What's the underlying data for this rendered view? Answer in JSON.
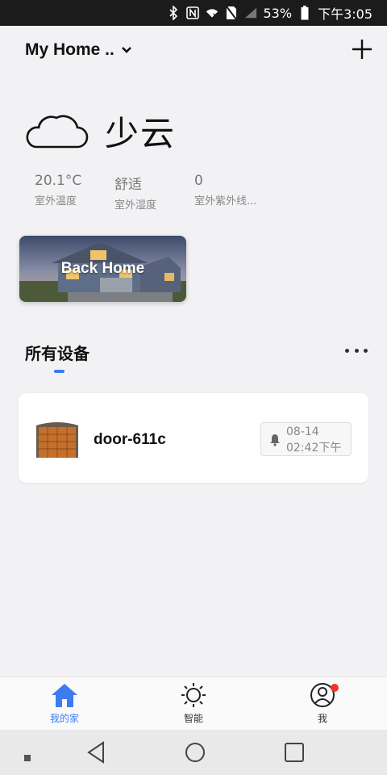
{
  "status_bar": {
    "battery": "53%",
    "time": "下午3:05",
    "icons": [
      "bluetooth-icon",
      "nfc-icon",
      "wifi-icon",
      "no-sim-icon",
      "signal-icon",
      "battery-icon"
    ]
  },
  "header": {
    "home_name": "My Home ..",
    "add_icon": "plus-icon"
  },
  "weather": {
    "condition": "少云",
    "icon": "cloud-icon",
    "stats": [
      {
        "value": "20.1°C",
        "label": "室外温度"
      },
      {
        "value": "舒适",
        "label": "室外湿度"
      },
      {
        "value": "0",
        "label": "室外紫外线..."
      }
    ]
  },
  "scene": {
    "label": "Back Home"
  },
  "devices_section": {
    "title": "所有设备",
    "more_icon": "more-icon"
  },
  "devices": [
    {
      "name": "door-611c",
      "notice_date": "08-14",
      "notice_time": "02:42下午",
      "icon": "garage-door-icon"
    }
  ],
  "bottom_nav": [
    {
      "label": "我的家",
      "icon": "home-icon",
      "active": true
    },
    {
      "label": "智能",
      "icon": "sun-icon",
      "active": false
    },
    {
      "label": "我",
      "icon": "user-icon",
      "active": false,
      "badge": true
    }
  ],
  "colors": {
    "accent": "#3c7cf0",
    "badge": "#f0352d",
    "background": "#f2f2f4"
  }
}
